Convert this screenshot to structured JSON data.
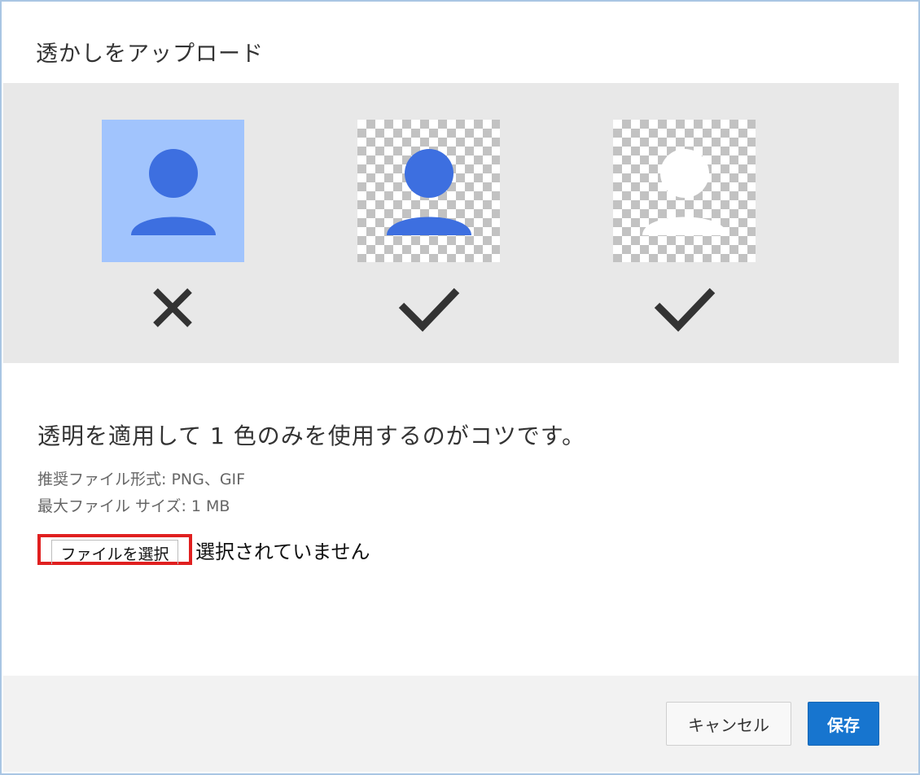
{
  "dialog": {
    "title": "透かしをアップロード"
  },
  "examples": [
    {
      "name": "solid-background-example",
      "valid": false,
      "mark_icon": "x-icon"
    },
    {
      "name": "transparent-colored-example",
      "valid": true,
      "mark_icon": "check-icon"
    },
    {
      "name": "transparent-white-example",
      "valid": true,
      "mark_icon": "check-icon"
    }
  ],
  "colors": {
    "example_bg": "#e8e8e8",
    "solid_bg": "#a1c4fd",
    "person_blue": "#3d6fe0",
    "person_white": "#ffffff",
    "mark": "#333333",
    "file_btn_highlight": "#e02020",
    "save_bg": "#1775cf"
  },
  "tip": "透明を適用して 1 色のみを使用するのがコツです。",
  "specs": {
    "formats": "推奨ファイル形式: PNG、GIF",
    "max_size": "最大ファイル サイズ: 1 MB"
  },
  "file": {
    "button_label": "ファイルを選択",
    "status": "選択されていません"
  },
  "footer": {
    "cancel_label": "キャンセル",
    "save_label": "保存"
  }
}
